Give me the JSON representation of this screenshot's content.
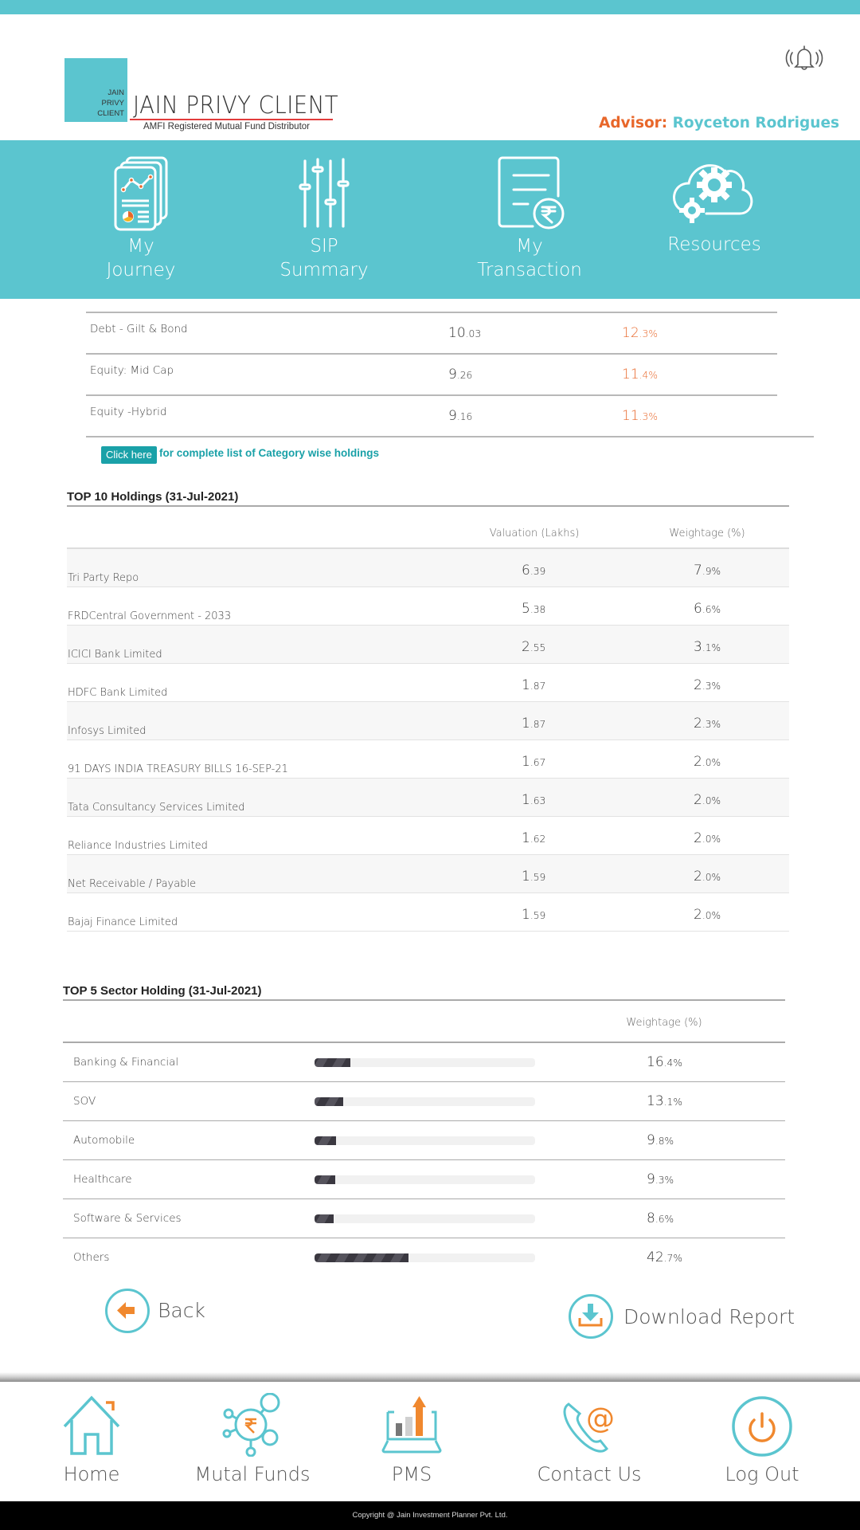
{
  "header": {
    "logo_square_lines": [
      "JAIN",
      "PRIVY",
      "CLIENT"
    ],
    "logo_title": "JAIN PRIVY CLIENT",
    "logo_subtitle": "AMFI Registered Mutual Fund Distributor",
    "advisor_label": "Advisor:",
    "advisor_name": "Royceton Rodrigues",
    "notification_icon": "bell-ringing-icon"
  },
  "top_nav": [
    {
      "label_line1": "My",
      "label_line2": "Journey",
      "icon": "report-chart-icon"
    },
    {
      "label_line1": "SIP",
      "label_line2": "Summary",
      "icon": "sliders-icon"
    },
    {
      "label_line1": "My",
      "label_line2": "Transaction",
      "icon": "rupee-document-icon"
    },
    {
      "label_line1": "Resources",
      "label_line2": "",
      "icon": "cloud-gears-icon"
    }
  ],
  "category_table": {
    "rows": [
      {
        "name": "Debt - Gilt & Bond",
        "value_int": "10",
        "value_dec": ".03",
        "pct_int": "12",
        "pct_dec": ".3%"
      },
      {
        "name": "Equity: Mid Cap",
        "value_int": "9",
        "value_dec": ".26",
        "pct_int": "11",
        "pct_dec": ".4%"
      },
      {
        "name": "Equity -Hybrid",
        "value_int": "9",
        "value_dec": ".16",
        "pct_int": "11",
        "pct_dec": ".3%"
      }
    ],
    "click_button": "Click here",
    "click_text": "for complete list of Category wise holdings"
  },
  "top_holdings": {
    "title": "TOP 10 Holdings (31-Jul-2021)",
    "col_valuation": "Valuation (Lakhs)",
    "col_weightage": "Weightage (%)",
    "rows": [
      {
        "name": "Tri Party Repo",
        "value_int": "6",
        "value_dec": ".39",
        "pct_int": "7",
        "pct_dec": ".9%"
      },
      {
        "name": "FRDCentral Government - 2033",
        "value_int": "5",
        "value_dec": ".38",
        "pct_int": "6",
        "pct_dec": ".6%"
      },
      {
        "name": "ICICI Bank Limited",
        "value_int": "2",
        "value_dec": ".55",
        "pct_int": "3",
        "pct_dec": ".1%"
      },
      {
        "name": "HDFC Bank Limited",
        "value_int": "1",
        "value_dec": ".87",
        "pct_int": "2",
        "pct_dec": ".3%"
      },
      {
        "name": "Infosys Limited",
        "value_int": "1",
        "value_dec": ".87",
        "pct_int": "2",
        "pct_dec": ".3%"
      },
      {
        "name": "91 DAYS INDIA TREASURY BILLS 16-SEP-21",
        "value_int": "1",
        "value_dec": ".67",
        "pct_int": "2",
        "pct_dec": ".0%"
      },
      {
        "name": "Tata Consultancy Services Limited",
        "value_int": "1",
        "value_dec": ".63",
        "pct_int": "2",
        "pct_dec": ".0%"
      },
      {
        "name": "Reliance Industries Limited",
        "value_int": "1",
        "value_dec": ".62",
        "pct_int": "2",
        "pct_dec": ".0%"
      },
      {
        "name": "Net Receivable / Payable",
        "value_int": "1",
        "value_dec": ".59",
        "pct_int": "2",
        "pct_dec": ".0%"
      },
      {
        "name": "Bajaj Finance Limited",
        "value_int": "1",
        "value_dec": ".59",
        "pct_int": "2",
        "pct_dec": ".0%"
      }
    ]
  },
  "sector_holdings": {
    "title": "TOP 5 Sector Holding (31-Jul-2021)",
    "col_weightage": "Weightage (%)",
    "rows": [
      {
        "name": "Banking & Financial",
        "percent": 16.4,
        "pct_int": "16",
        "pct_dec": ".4%"
      },
      {
        "name": "SOV",
        "percent": 13.1,
        "pct_int": "13",
        "pct_dec": ".1%"
      },
      {
        "name": "Automobile",
        "percent": 9.8,
        "pct_int": "9",
        "pct_dec": ".8%"
      },
      {
        "name": "Healthcare",
        "percent": 9.3,
        "pct_int": "9",
        "pct_dec": ".3%"
      },
      {
        "name": "Software & Services",
        "percent": 8.6,
        "pct_int": "8",
        "pct_dec": ".6%"
      },
      {
        "name": "Others",
        "percent": 42.7,
        "pct_int": "42",
        "pct_dec": ".7%"
      }
    ]
  },
  "actions": {
    "back_label": "Back",
    "download_label": "Download Report"
  },
  "bottom_nav": [
    {
      "label": "Home",
      "icon": "home-icon"
    },
    {
      "label": "Mutal Funds",
      "icon": "rupee-network-icon"
    },
    {
      "label": "PMS",
      "icon": "laptop-growth-icon"
    },
    {
      "label": "Contact Us",
      "icon": "phone-at-icon"
    },
    {
      "label": "Log Out",
      "icon": "power-icon"
    }
  ],
  "footer": {
    "copyright": "Copyright @ Jain Investment Planner Pvt. Ltd."
  },
  "colors": {
    "teal": "#5bc5cf",
    "orange": "#e8672a",
    "button_teal": "#1aa1a8"
  }
}
